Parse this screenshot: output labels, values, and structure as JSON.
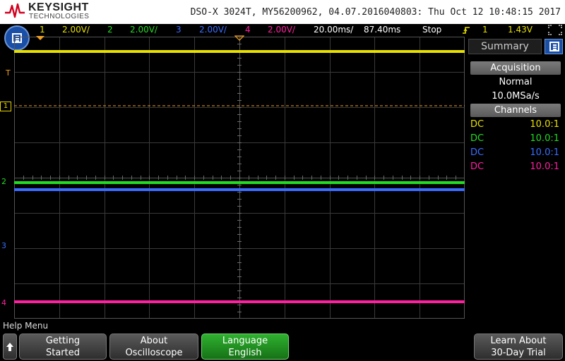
{
  "brand": {
    "name": "KEYSIGHT",
    "subtitle": "TECHNOLOGIES"
  },
  "title": "DSO-X 3024T, MY56200962, 04.07.2016040803: Thu Oct 12 10:48:15 2017",
  "status": {
    "ch1": {
      "num": "1",
      "scale": "2.00V/"
    },
    "ch2": {
      "num": "2",
      "scale": "2.00V/"
    },
    "ch3": {
      "num": "3",
      "scale": "2.00V/"
    },
    "ch4": {
      "num": "4",
      "scale": "2.00V/"
    },
    "timebase": "20.00ms/",
    "delay": "87.40ms",
    "run_state": "Stop",
    "trigger_icon": "trigger-edge-icon",
    "trigger_source": "1",
    "trigger_level": "1.43V",
    "icon": "corner-bracket-icon"
  },
  "markers": {
    "trig_t": "T",
    "trig_level": "1",
    "ch2": "2",
    "ch3": "3",
    "ch4": "4"
  },
  "colors": {
    "ch1": "#e8e000",
    "ch2": "#22dd22",
    "ch3": "#3a6dff",
    "ch4": "#ff1fa0",
    "trigger": "#f0a020",
    "menu": "#1a4fa8"
  },
  "panel": {
    "tab": "Summary",
    "acquisition": {
      "header": "Acquisition",
      "mode": "Normal",
      "rate": "10.0MSa/s"
    },
    "channels": {
      "header": "Channels",
      "rows": [
        {
          "coupling": "DC",
          "probe": "10.0:1"
        },
        {
          "coupling": "DC",
          "probe": "10.0:1"
        },
        {
          "coupling": "DC",
          "probe": "10.0:1"
        },
        {
          "coupling": "DC",
          "probe": "10.0:1"
        }
      ]
    }
  },
  "help_menu": {
    "label": "Help Menu",
    "up_icon": "up-arrow-icon",
    "keys": [
      {
        "line1": "Getting",
        "line2": "Started"
      },
      {
        "line1": "About",
        "line2": "Oscilloscope"
      },
      {
        "line1": "Language",
        "line2": "English"
      },
      {
        "line1": "Learn About",
        "line2": "30-Day Trial"
      }
    ]
  }
}
